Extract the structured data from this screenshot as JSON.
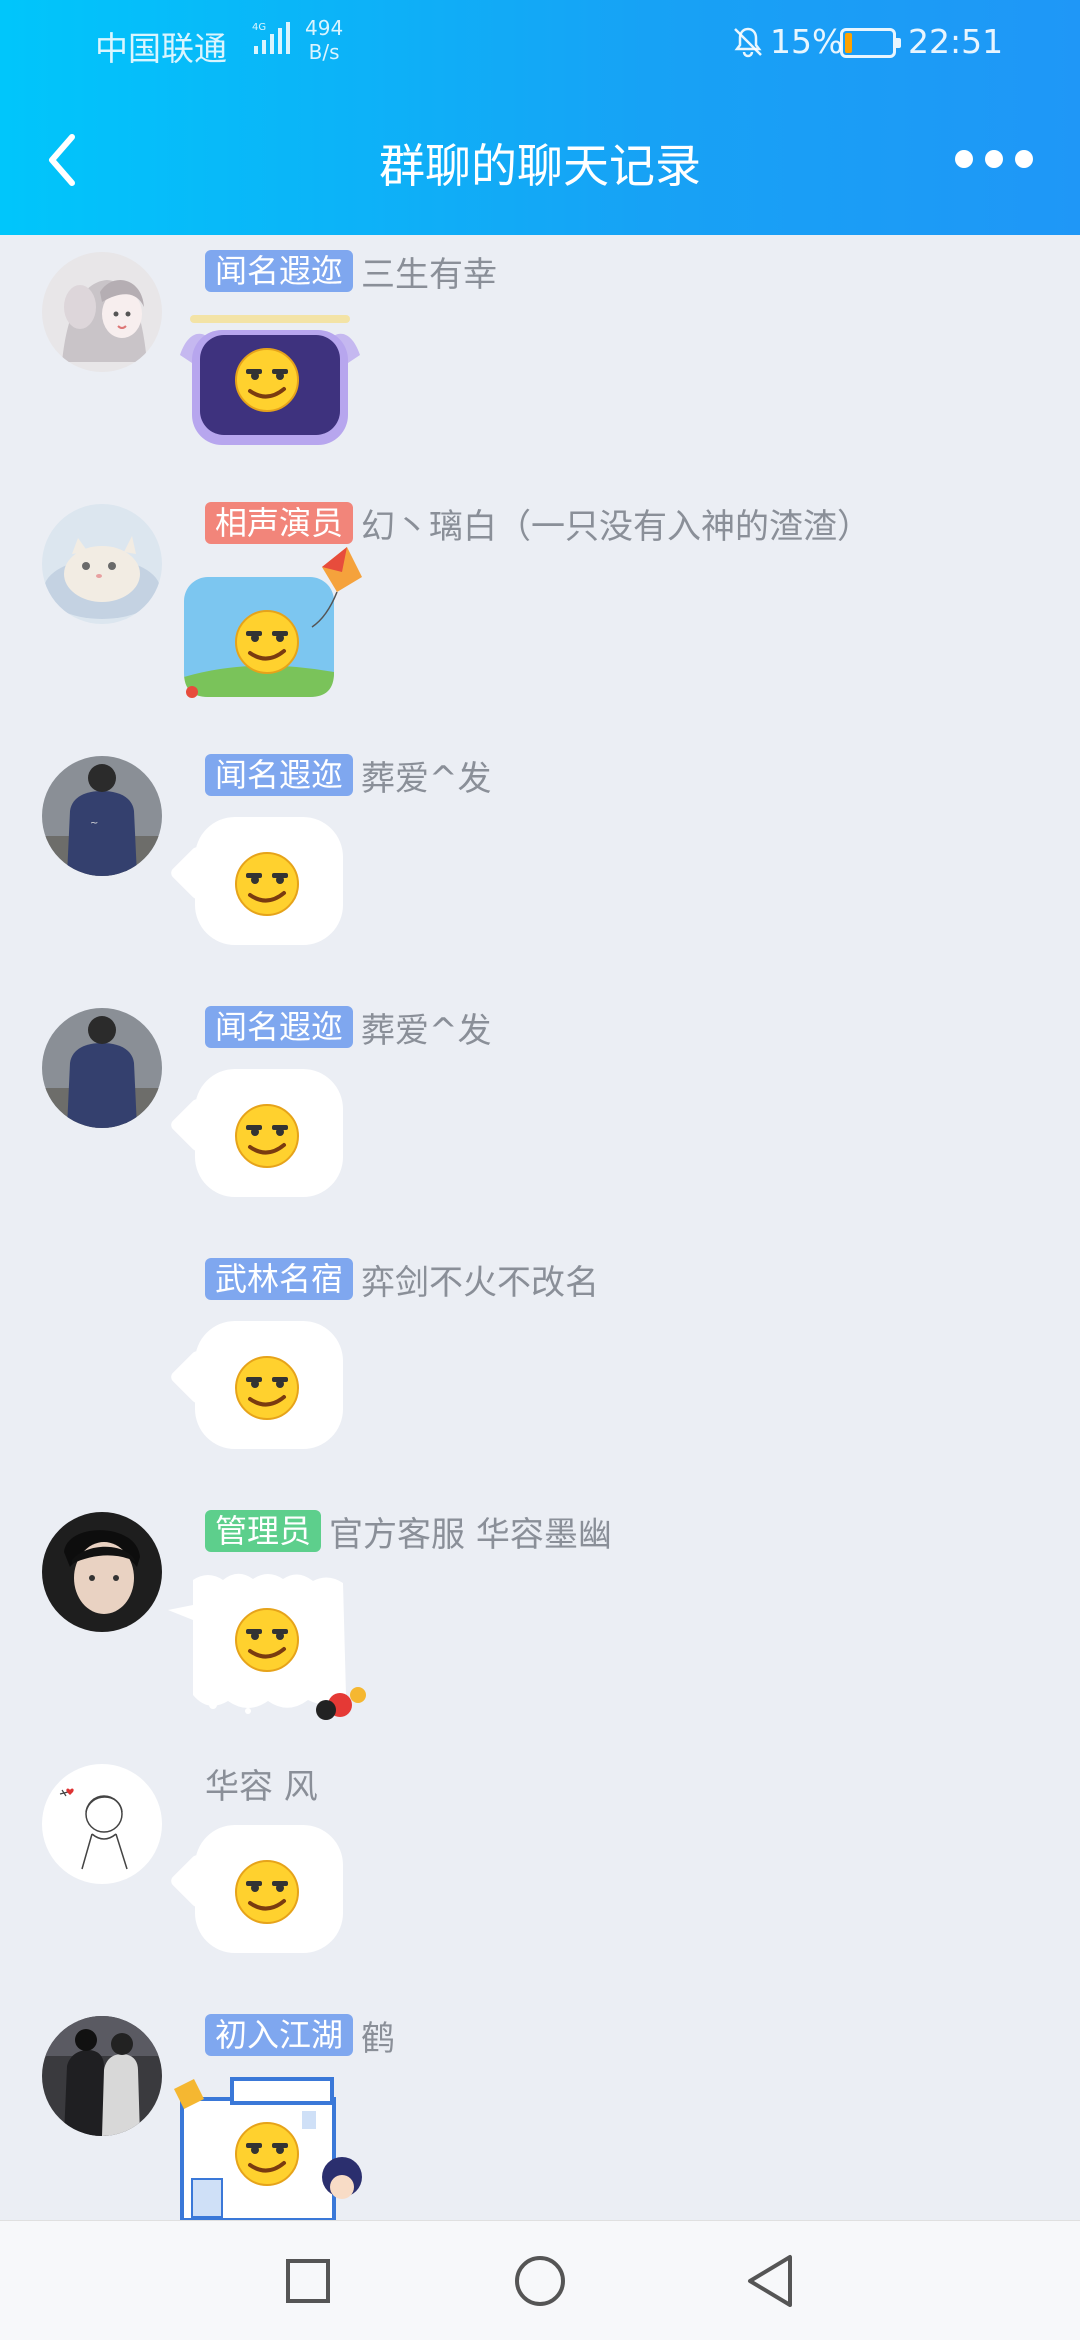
{
  "status_bar": {
    "carrier": "中国联通",
    "network": "4G⁺",
    "speed_value": "494",
    "speed_unit": "B/s",
    "battery_percent": "15%",
    "battery_level": 0.15,
    "time": "22:51"
  },
  "header": {
    "title": "群聊的聊天记录",
    "back_icon": "chevron-left-icon",
    "more_icon": "more-dots-icon"
  },
  "colors": {
    "header_start": "#00c6fb",
    "header_end": "#1f97f7",
    "background": "#ebeef4",
    "tag_blue": "#7fa7ef",
    "tag_red": "#f2857a",
    "tag_green": "#5dcf8c",
    "name_text": "#8a8f98"
  },
  "messages": [
    {
      "tag": "闻名遐迩",
      "tag_color": "#7fa7ef",
      "name": "三生有幸",
      "avatar": "anime-girl-avatar",
      "bubble": "purple-winged-frame"
    },
    {
      "tag": "相声演员",
      "tag_color": "#f2857a",
      "name": "幻丶璃白（一只没有入神的渣渣）",
      "avatar": "cat-avatar",
      "bubble": "kite-sky-frame"
    },
    {
      "tag": "闻名遐迩",
      "tag_color": "#7fa7ef",
      "name": "葬爱^发",
      "avatar": "boy-photo-avatar",
      "bubble": "plain-white"
    },
    {
      "tag": "闻名遐迩",
      "tag_color": "#7fa7ef",
      "name": "葬爱^发",
      "avatar": "boy-photo-avatar",
      "bubble": "plain-white"
    },
    {
      "tag": "武林名宿",
      "tag_color": "#7fa7ef",
      "name": "弈剑不火不改名",
      "avatar": "",
      "bubble": "plain-white"
    },
    {
      "tag": "管理员",
      "tag_color": "#5dcf8c",
      "name": "官方客服  华容墨幽",
      "avatar": "boy-portrait-avatar",
      "bubble": "snow-frame"
    },
    {
      "tag": "",
      "tag_color": "",
      "name": "华容 风",
      "avatar": "sketch-avatar",
      "bubble": "plain-white"
    },
    {
      "tag": "初入江湖",
      "tag_color": "#7fa7ef",
      "name": "鹤",
      "avatar": "couple-photo-avatar",
      "bubble": "building-frame"
    }
  ],
  "emoji": "smirk-face-icon",
  "nav": {
    "recent_icon": "square-icon",
    "home_icon": "circle-icon",
    "back_icon": "triangle-back-icon"
  }
}
